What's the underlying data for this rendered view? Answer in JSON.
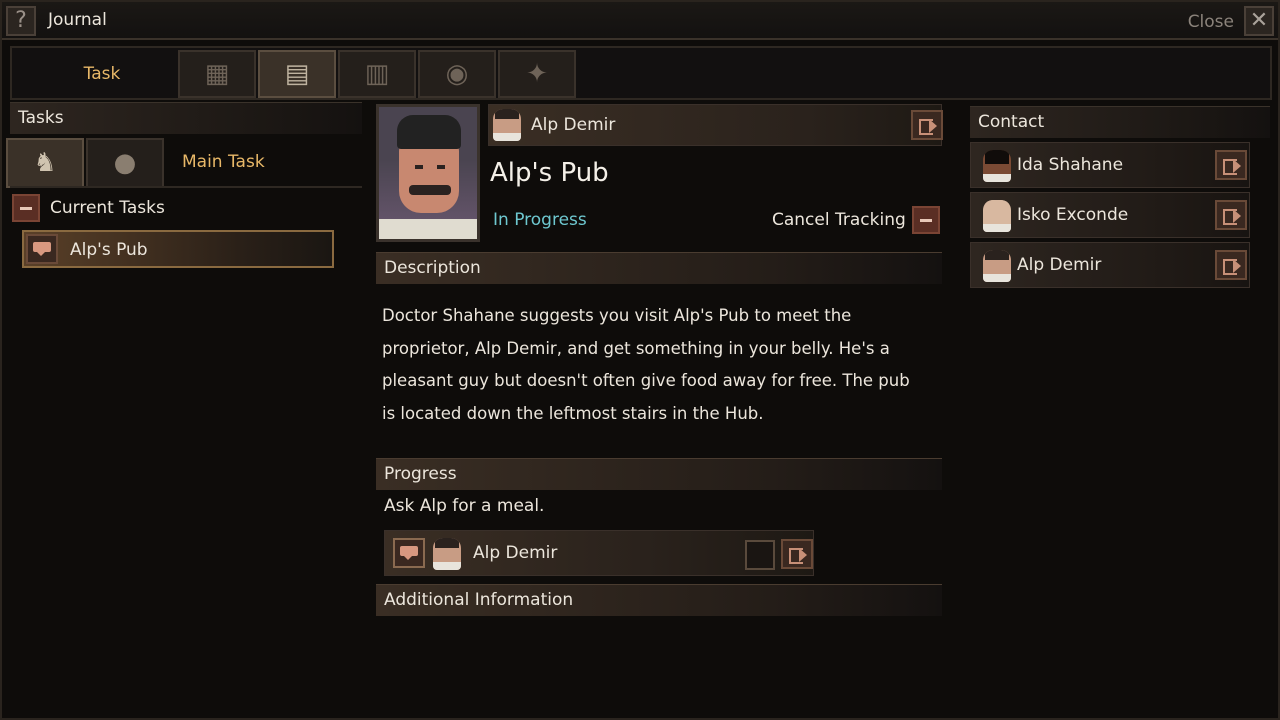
{
  "window": {
    "title": "Journal",
    "close_label": "Close",
    "help_glyph": "?",
    "close_glyph": "✕"
  },
  "tabs": {
    "task_label": "Task",
    "icons": [
      {
        "name": "map-scroll-icon",
        "glyph": "▦",
        "active": false
      },
      {
        "name": "documents-icon",
        "glyph": "▤",
        "active": true
      },
      {
        "name": "book-icon",
        "glyph": "▥",
        "active": false
      },
      {
        "name": "magnifier-icon",
        "glyph": "◉",
        "active": false
      },
      {
        "name": "gear-tools-icon",
        "glyph": "✦",
        "active": false
      }
    ]
  },
  "tasks_panel": {
    "header": "Tasks",
    "subtab_icons": [
      {
        "name": "figure-icon",
        "glyph": "♞",
        "active": true
      },
      {
        "name": "sack-icon",
        "glyph": "●",
        "active": false
      }
    ],
    "main_task_label": "Main Task",
    "current_tasks_label": "Current Tasks",
    "items": [
      {
        "label": "Alp's Pub"
      }
    ]
  },
  "quest": {
    "npc_name": "Alp Demir",
    "title": "Alp's Pub",
    "status": "In Progress",
    "cancel_label": "Cancel Tracking",
    "description_header": "Description",
    "description": "Doctor Shahane suggests you visit Alp's Pub to meet the proprietor, Alp Demir, and get something in your belly. He's a pleasant guy but doesn't often give food away for free. The pub is located down the leftmost stairs in the Hub.",
    "progress_header": "Progress",
    "progress_text": "Ask Alp for a meal.",
    "progress_npc": "Alp Demir",
    "additional_header": "Additional Information"
  },
  "contacts": {
    "header": "Contact",
    "items": [
      {
        "name": "Ida Shahane"
      },
      {
        "name": "Isko Exconde"
      },
      {
        "name": "Alp Demir"
      }
    ]
  },
  "colors": {
    "accent_gold": "#e8b868",
    "status_cyan": "#6ec8d0",
    "text": "#ece6dc"
  }
}
